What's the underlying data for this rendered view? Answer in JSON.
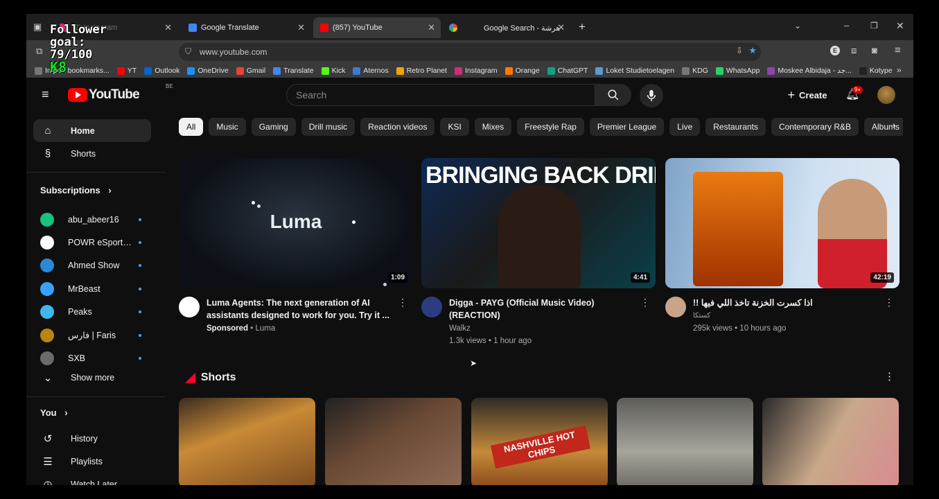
{
  "browser": {
    "tabs": [
      {
        "title": "(2) Instagram",
        "color": "#d62976"
      },
      {
        "title": "Google Translate",
        "color": "#4285f4"
      },
      {
        "title": "(857) YouTube",
        "color": "#ff0000"
      },
      {
        "title": "",
        "color": "#ffffff"
      },
      {
        "title": "Google Search - هرشة",
        "color": "#ffffff"
      }
    ],
    "url": "www.youtube.com",
    "bookmarks": [
      {
        "label": "Import bookmarks...",
        "color": "#777777"
      },
      {
        "label": "YT",
        "color": "#ff0000"
      },
      {
        "label": "Outlook",
        "color": "#0a64c8"
      },
      {
        "label": "OneDrive",
        "color": "#1e90ff"
      },
      {
        "label": "Gmail",
        "color": "#ea4335"
      },
      {
        "label": "Translate",
        "color": "#4285f4"
      },
      {
        "label": "Kick",
        "color": "#53fc18"
      },
      {
        "label": "Aternos",
        "color": "#3a7bd5"
      },
      {
        "label": "Retro Planet",
        "color": "#f4a300"
      },
      {
        "label": "Instagram",
        "color": "#d62976"
      },
      {
        "label": "Orange",
        "color": "#ff7900"
      },
      {
        "label": "ChatGPT",
        "color": "#10a37f"
      },
      {
        "label": "Loket Studietoelagen",
        "color": "#5b9bd5"
      },
      {
        "label": "KDG",
        "color": "#777777"
      },
      {
        "label": "WhatsApp",
        "color": "#25d366"
      },
      {
        "label": "Moskee Albidaja - جد...",
        "color": "#8e44ad"
      },
      {
        "label": "Kotype",
        "color": "#222222"
      }
    ]
  },
  "overlay": {
    "line1": "Follower",
    "line2": "goal:",
    "line3": "79/100",
    "line4": "K8"
  },
  "youtube": {
    "logo": "YouTube",
    "country": "BE",
    "search_placeholder": "Search",
    "create_label": "Create",
    "notif_count": "9+"
  },
  "sidebar": {
    "home": "Home",
    "shorts": "Shorts",
    "subscriptions_title": "Subscriptions",
    "subscriptions": [
      {
        "name": "abu_abeer16",
        "color": "#19c37d"
      },
      {
        "name": "POWR eSports | ...",
        "color": "#ffffff"
      },
      {
        "name": "Ahmed Show",
        "color": "#2b8ad6"
      },
      {
        "name": "MrBeast",
        "color": "#3aa0ff"
      },
      {
        "name": "Peaks",
        "color": "#3fb8f0"
      },
      {
        "name": "فارس | Faris",
        "color": "#b8860b"
      },
      {
        "name": "SXB",
        "color": "#6a6a6a"
      }
    ],
    "show_more": "Show more",
    "you_title": "You",
    "you_items": [
      "History",
      "Playlists",
      "Watch Later"
    ]
  },
  "chips": [
    "All",
    "Music",
    "Gaming",
    "Drill music",
    "Reaction videos",
    "KSI",
    "Mixes",
    "Freestyle Rap",
    "Premier League",
    "Live",
    "Restaurants",
    "Contemporary R&B",
    "Albums"
  ],
  "videos": [
    {
      "title": "Luma Agents: The next generation of AI assistants designed to work for you. Try it ...",
      "line2": "Sponsored",
      "line2b": " • Luma",
      "line3": "",
      "duration": "1:09",
      "thumb_text": "Luma"
    },
    {
      "title": "Digga - PAYG (Official Music Video) (REACTION)",
      "line2": "Walkz",
      "line2b": "",
      "line3": "1.3k views • 1 hour ago",
      "duration": "4:41",
      "thumb_text": "BRINGING BACK DRILL"
    },
    {
      "title": "!! اذا كسرت الخزنة تاخذ اللي فيها",
      "line2": "كستكا",
      "line2b": "",
      "line3": "295k views • 10 hours ago",
      "duration": "42:19",
      "thumb_text": ""
    }
  ],
  "shorts": {
    "title": "Shorts",
    "card_text": "NASHVILLE HOT CHIPS"
  }
}
